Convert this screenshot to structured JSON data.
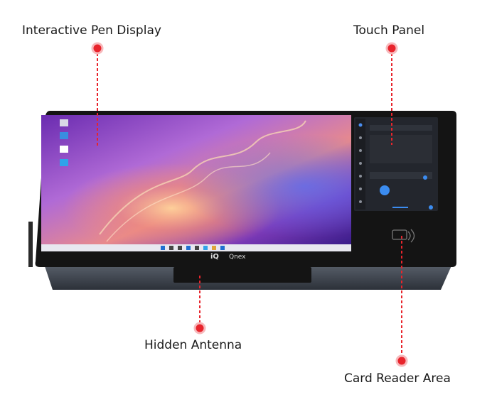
{
  "callouts": {
    "pen_display": "Interactive Pen Display",
    "touch_panel": "Touch Panel",
    "hidden_antenna": "Hidden Antenna",
    "card_reader": "Card Reader Area"
  },
  "device": {
    "brand_left": "iQ",
    "brand_right": "Qnex"
  },
  "colors": {
    "callout_dot": "#e8242c",
    "bezel": "#141414",
    "base": "#3f4651"
  }
}
